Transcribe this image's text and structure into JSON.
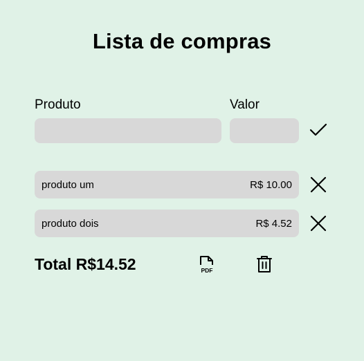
{
  "page": {
    "title": "Lista de compras",
    "background_color": "#e0f2e7"
  },
  "form": {
    "product_label": "Produto",
    "value_label": "Valor",
    "product_value": "",
    "value_value": "",
    "input_color": "#d8d8d8",
    "confirm_icon": "check-icon"
  },
  "items": [
    {
      "name": "produto um",
      "price": "R$ 10.00",
      "remove_icon": "close-icon"
    },
    {
      "name": "produto dois",
      "price": "R$ 4.52",
      "remove_icon": "close-icon"
    }
  ],
  "footer": {
    "total_text": "Total R$14.52",
    "export_icon": "pdf-icon",
    "export_icon_text": "PDF",
    "clear_icon": "trash-icon"
  }
}
